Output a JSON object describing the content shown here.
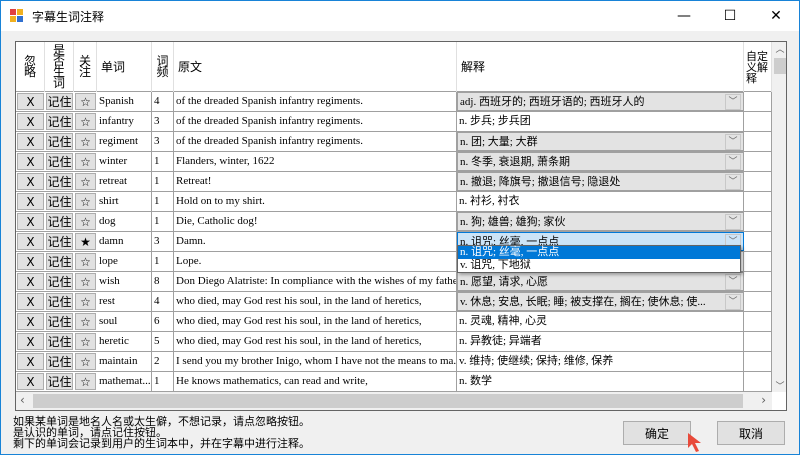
{
  "window": {
    "title": "字幕生词注释",
    "minimize": "—",
    "maximize": "☐",
    "close": "✕"
  },
  "columns": {
    "ignore": "忽略",
    "is_new": "是否生词",
    "follow": "关注",
    "word": "单词",
    "freq": "词频",
    "text": "原文",
    "meaning": "解释",
    "custom": "自定义解释"
  },
  "rows": [
    {
      "ignore": "X",
      "remember": "记住",
      "star": "☆",
      "word": "Spanish",
      "freq": "4",
      "text": "of the dreaded Spanish infantry regiments.",
      "meaning": "adj.  西班牙的; 西班牙语的; 西班牙人的",
      "dropdown": true
    },
    {
      "ignore": "X",
      "remember": "记住",
      "star": "☆",
      "word": "infantry",
      "freq": "3",
      "text": "of the dreaded Spanish infantry regiments.",
      "meaning": "n.  步兵; 步兵团",
      "dropdown": false
    },
    {
      "ignore": "X",
      "remember": "记住",
      "star": "☆",
      "word": "regiment",
      "freq": "3",
      "text": "of the dreaded Spanish infantry regiments.",
      "meaning": "n.  团; 大量; 大群",
      "dropdown": true
    },
    {
      "ignore": "X",
      "remember": "记住",
      "star": "☆",
      "word": "winter",
      "freq": "1",
      "text": "Flanders, winter, 1622",
      "meaning": "n.  冬季, 衰退期, 萧条期",
      "dropdown": true
    },
    {
      "ignore": "X",
      "remember": "记住",
      "star": "☆",
      "word": "retreat",
      "freq": "1",
      "text": "Retreat!",
      "meaning": "n.  撤退; 降旗号; 撤退信号; 隐退处",
      "dropdown": true
    },
    {
      "ignore": "X",
      "remember": "记住",
      "star": "☆",
      "word": "shirt",
      "freq": "1",
      "text": "Hold on to my shirt.",
      "meaning": "n.  衬衫, 衬衣",
      "dropdown": false
    },
    {
      "ignore": "X",
      "remember": "记住",
      "star": "☆",
      "word": "dog",
      "freq": "1",
      "text": "Die, Catholic dog!",
      "meaning": "n.  狗; 雄兽; 雄狗; 家伙",
      "dropdown": true
    },
    {
      "ignore": "X",
      "remember": "记住",
      "star": "★",
      "word": "damn",
      "freq": "3",
      "text": "Damn.",
      "meaning": "n.  诅咒; 丝毫, 一点点",
      "dropdown": true,
      "selected": true
    },
    {
      "ignore": "X",
      "remember": "记住",
      "star": "☆",
      "word": "lope",
      "freq": "1",
      "text": "Lope.",
      "meaning": "",
      "dropdown": false
    },
    {
      "ignore": "X",
      "remember": "记住",
      "star": "☆",
      "word": "wish",
      "freq": "8",
      "text": "Don Diego Alatriste: In compliance  with the wishes of my father,",
      "meaning": "n.  愿望, 请求, 心愿",
      "dropdown": true
    },
    {
      "ignore": "X",
      "remember": "记住",
      "star": "☆",
      "word": "rest",
      "freq": "4",
      "text": "who died, may God rest his soul,  in the land of heretics,",
      "meaning": "v.  休息; 安息, 长眠; 睡; 被支撑在, 搁在; 使休息; 使...",
      "dropdown": true
    },
    {
      "ignore": "X",
      "remember": "记住",
      "star": "☆",
      "word": "soul",
      "freq": "6",
      "text": "who died, may God rest his soul,  in the land of heretics,",
      "meaning": "n.  灵魂, 精神, 心灵",
      "dropdown": false
    },
    {
      "ignore": "X",
      "remember": "记住",
      "star": "☆",
      "word": "heretic",
      "freq": "5",
      "text": "who died, may God rest his soul,  in the land of heretics,",
      "meaning": "n.  异教徒; 异端者",
      "dropdown": false
    },
    {
      "ignore": "X",
      "remember": "记住",
      "star": "☆",
      "word": "maintain",
      "freq": "2",
      "text": "I send you my brother Inigo, whom  I have not the means to ma...",
      "meaning": "v.  维持; 使继续; 保持; 维修, 保养",
      "dropdown": false
    },
    {
      "ignore": "X",
      "remember": "记住",
      "star": "☆",
      "word": "mathemat...",
      "freq": "1",
      "text": "He knows mathematics,  can read and write,",
      "meaning": "n.  数学",
      "dropdown": false
    }
  ],
  "dropdown_options": [
    "n.  诅咒; 丝毫, 一点点",
    "v.  诅咒, 下地狱"
  ],
  "help": [
    "如果某单词是地名人名或太生僻，不想记录，请点忽略按钮。",
    "是认识的单词，请点记住按钮。",
    "剩下的单词会记录到用户的生词本中，并在字幕中进行注释。"
  ],
  "buttons": {
    "ok": "确定",
    "cancel": "取消"
  }
}
